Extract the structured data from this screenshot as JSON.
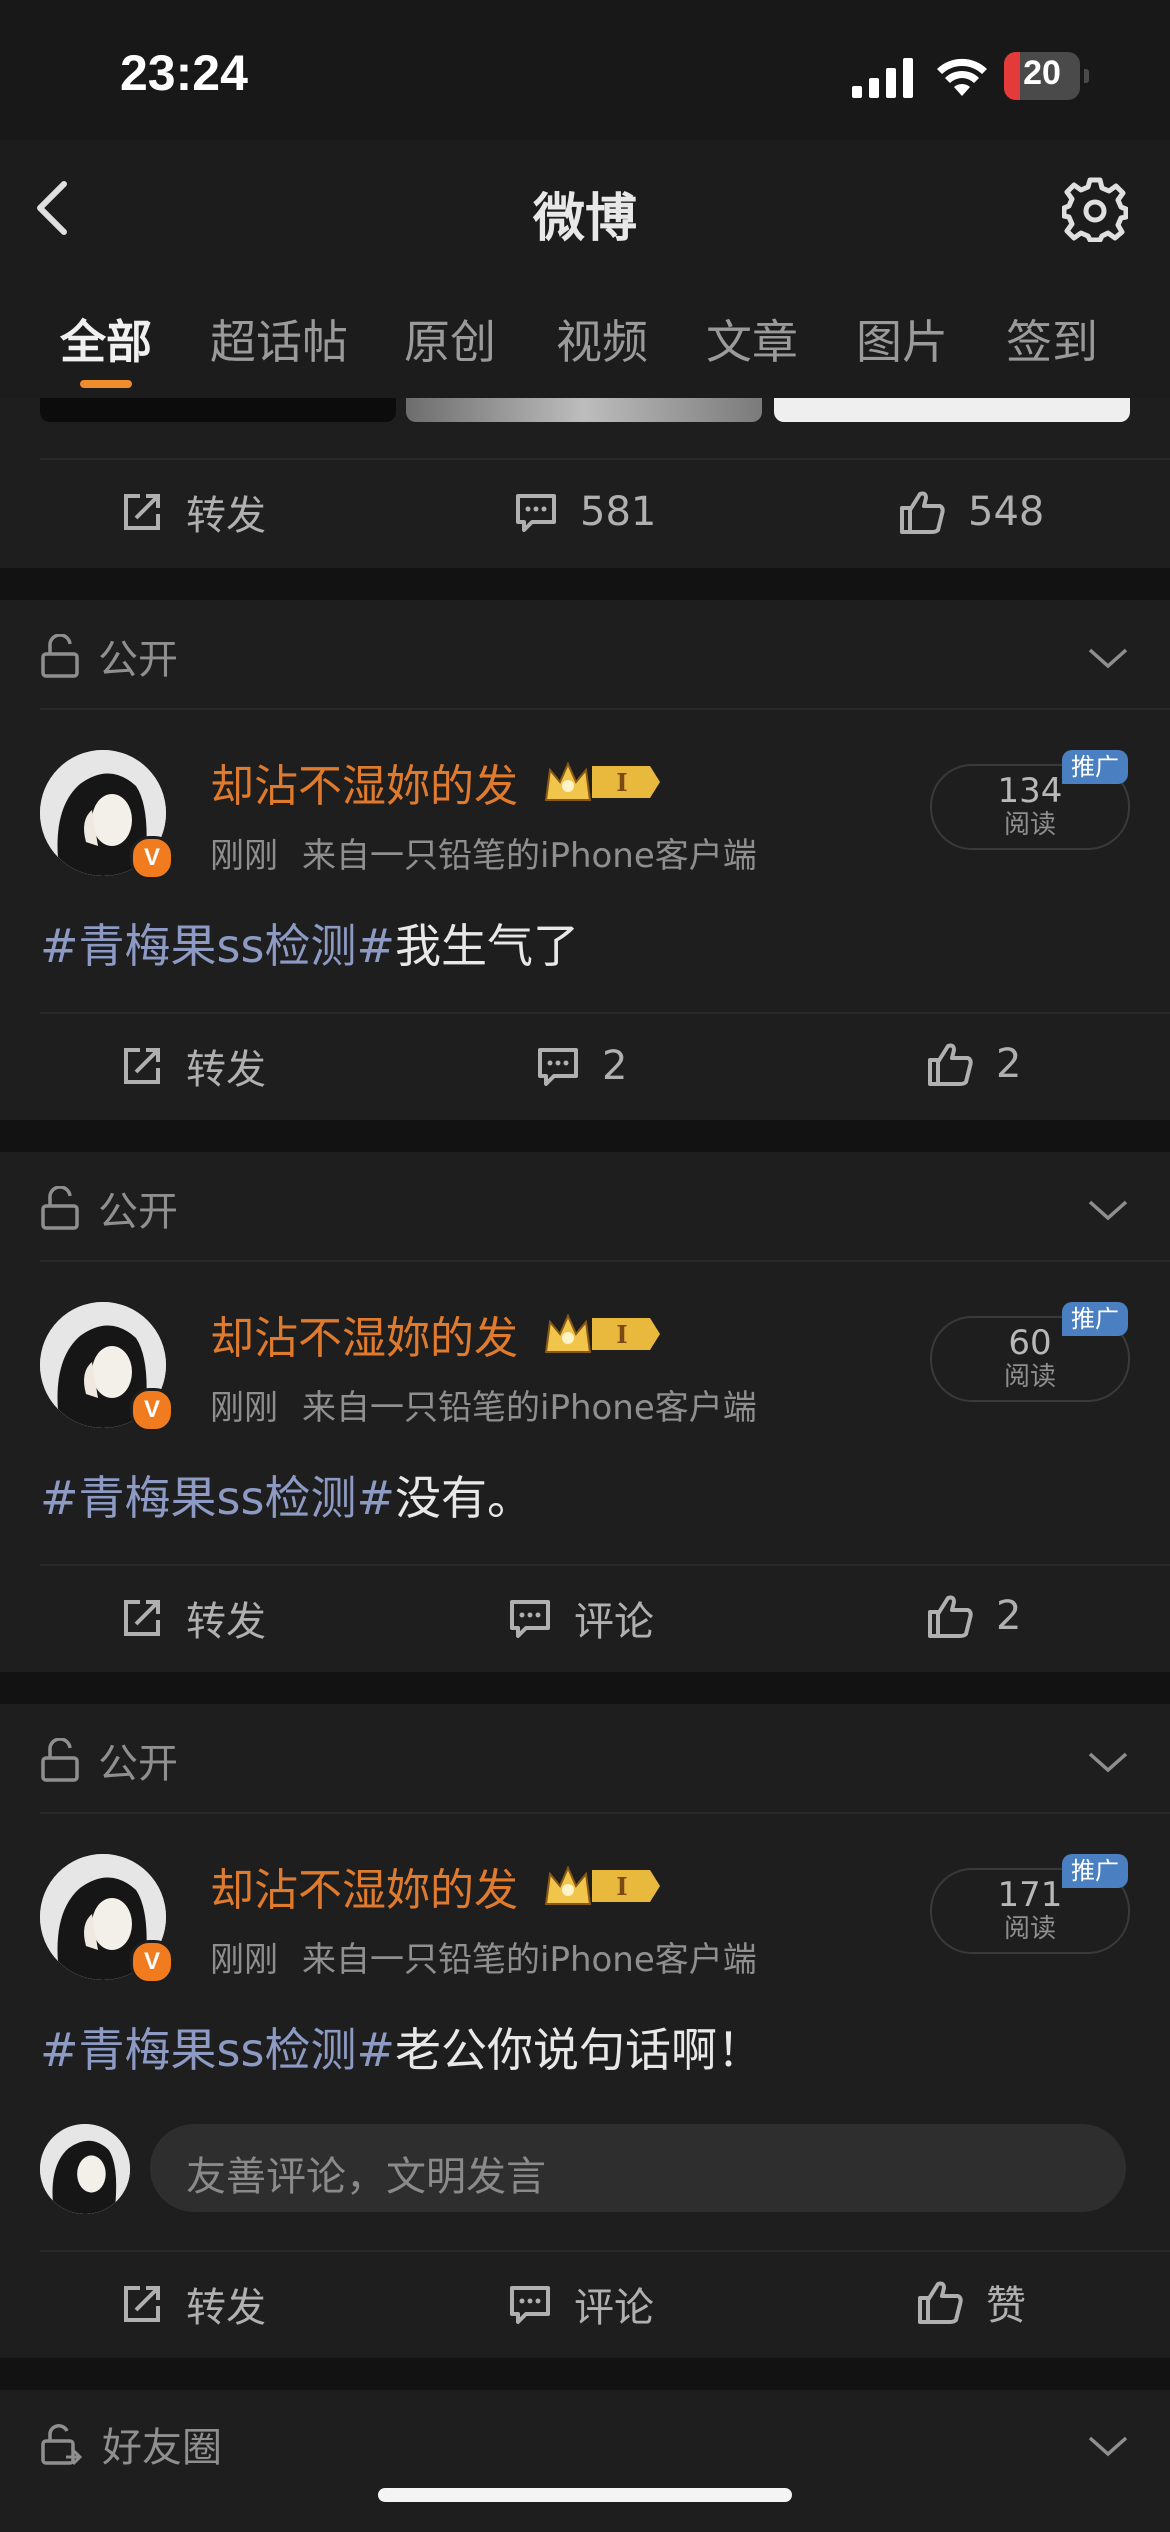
{
  "status_bar": {
    "time": "23:24",
    "battery": "20"
  },
  "header": {
    "title": "微博"
  },
  "tabs": [
    {
      "label": "全部"
    },
    {
      "label": "超话帖"
    },
    {
      "label": "原创"
    },
    {
      "label": "视频"
    },
    {
      "label": "文章"
    },
    {
      "label": "图片"
    },
    {
      "label": "签到"
    }
  ],
  "top_actions": {
    "repost": "转发",
    "comments": "581",
    "likes": "548"
  },
  "posts": [
    {
      "visibility": "公开",
      "user": "却沾不湿妳的发",
      "time": "刚刚",
      "source": "来自一只铅笔的iPhone客户端",
      "reads": "134",
      "reads_label": "阅读",
      "promo": "推广",
      "topic": "#青梅果ss检测#",
      "text": "我生气了",
      "repost": "转发",
      "comments": "2",
      "likes": "2"
    },
    {
      "visibility": "公开",
      "user": "却沾不湿妳的发",
      "time": "刚刚",
      "source": "来自一只铅笔的iPhone客户端",
      "reads": "60",
      "reads_label": "阅读",
      "promo": "推广",
      "topic": "#青梅果ss检测#",
      "text": "没有。",
      "repost": "转发",
      "comments": "评论",
      "likes": "2"
    },
    {
      "visibility": "公开",
      "user": "却沾不湿妳的发",
      "time": "刚刚",
      "source": "来自一只铅笔的iPhone客户端",
      "reads": "171",
      "reads_label": "阅读",
      "promo": "推广",
      "topic": "#青梅果ss检测#",
      "text": "老公你说句话啊！",
      "comment_placeholder": "友善评论，文明发言",
      "repost": "转发",
      "comments": "评论",
      "likes": "赞"
    }
  ],
  "friends_circle": {
    "label": "好友圈"
  }
}
